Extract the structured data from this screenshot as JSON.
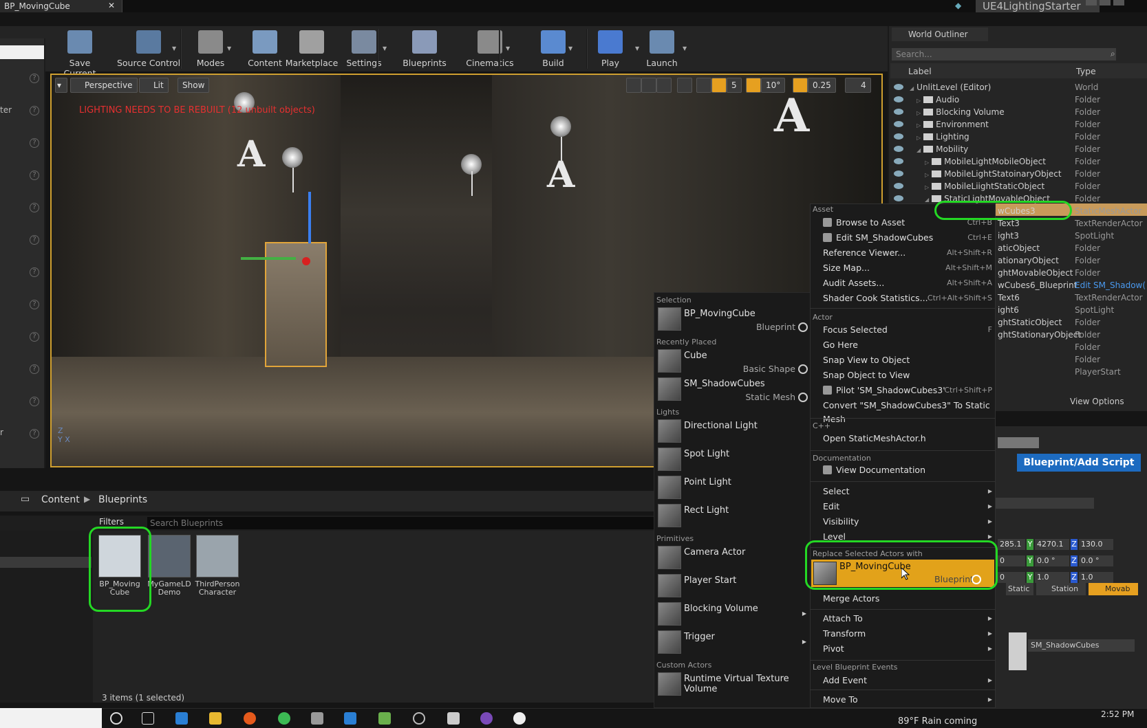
{
  "window": {
    "tab_title": "BP_MovingCube",
    "project_name": "UE4LightingStarter"
  },
  "toolbar": {
    "buttons": [
      "Save Current",
      "Source Control",
      "Modes",
      "Content",
      "Marketplace",
      "Settings",
      "Blueprints",
      "Cinematics",
      "Build",
      "Play",
      "Launch"
    ]
  },
  "viewport": {
    "perspective": "Perspective",
    "lit": "Lit",
    "show": "Show",
    "warning": "LIGHTING NEEDS TO BE REBUILT (12 unbuilt objects)",
    "grid_snap": "5",
    "rot_snap": "10°",
    "scale_snap": "0.25",
    "cam_speed": "4"
  },
  "left_labels": [
    "ter",
    "r"
  ],
  "outliner": {
    "title": "World Outliner",
    "search_placeholder": "Search...",
    "col_label": "Label",
    "col_type": "Type",
    "rows": [
      {
        "label": "UnlitLevel (Editor)",
        "type": "World"
      },
      {
        "label": "Audio",
        "type": "Folder"
      },
      {
        "label": "Blocking Volume",
        "type": "Folder"
      },
      {
        "label": "Environment",
        "type": "Folder"
      },
      {
        "label": "Lighting",
        "type": "Folder"
      },
      {
        "label": "Mobility",
        "type": "Folder"
      },
      {
        "label": "MobileLightMobileObject",
        "type": "Folder"
      },
      {
        "label": "MobileLightStatoinaryObject",
        "type": "Folder"
      },
      {
        "label": "MobileLiightStaticObject",
        "type": "Folder"
      },
      {
        "label": "StaticLightMovableObject",
        "type": "Folder"
      },
      {
        "label": "wCubes3",
        "type": "StaticMeshActor"
      },
      {
        "label": "Text3",
        "type": "TextRenderActor"
      },
      {
        "label": "ight3",
        "type": "SpotLight"
      },
      {
        "label": "aticObject",
        "type": "Folder"
      },
      {
        "label": "ationaryObject",
        "type": "Folder"
      },
      {
        "label": "ghtMovableObject",
        "type": "Folder"
      },
      {
        "label": "wCubes6_Blueprint",
        "type": "Edit SM_Shadow("
      },
      {
        "label": "Text6",
        "type": "TextRenderActor"
      },
      {
        "label": "ight6",
        "type": "SpotLight"
      },
      {
        "label": "ghtStaticObject",
        "type": "Folder"
      },
      {
        "label": "ghtStationaryObject",
        "type": "Folder"
      },
      {
        "label": "",
        "type": "Folder"
      },
      {
        "label": "",
        "type": "Folder"
      },
      {
        "label": "",
        "type": "PlayerStart"
      }
    ],
    "view_options": "View Options"
  },
  "details": {
    "blueprint_button": "Blueprint/Add Script",
    "loc": [
      "285.1",
      "4270.1",
      "130.0"
    ],
    "rot": [
      "0",
      "0.0 °",
      "0.0 °"
    ],
    "scale": [
      "0",
      "1.0",
      "1.0"
    ],
    "mobility": [
      "Static",
      "Station",
      "Movab"
    ],
    "mesh": "SM_ShadowCubes"
  },
  "content_browser": {
    "crumb_content": "Content",
    "crumb_blueprints": "Blueprints",
    "filters": "Filters",
    "search_placeholder": "Search Blueprints",
    "assets": [
      {
        "name": "BP_Moving\nCube"
      },
      {
        "name": "MyGameLD\nDemo"
      },
      {
        "name": "ThirdPerson\nCharacter"
      }
    ],
    "count": "3 items (1 selected)"
  },
  "place_menu": {
    "sections": [
      {
        "title": "Selection",
        "items": [
          {
            "name": "BP_MovingCube",
            "type": "Blueprint",
            "circle": true
          }
        ]
      },
      {
        "title": "Recently Placed",
        "items": [
          {
            "name": "Cube",
            "type": "Basic Shape",
            "circle": true
          },
          {
            "name": "SM_ShadowCubes",
            "type": "Static Mesh",
            "circle": true
          }
        ]
      },
      {
        "title": "Lights",
        "items": [
          {
            "name": "Directional Light"
          },
          {
            "name": "Spot Light"
          },
          {
            "name": "Point Light"
          },
          {
            "name": "Rect Light"
          }
        ]
      },
      {
        "title": "Primitives",
        "items": [
          {
            "name": "Camera Actor"
          },
          {
            "name": "Player Start"
          },
          {
            "name": "Blocking Volume",
            "arrow": true
          },
          {
            "name": "Trigger",
            "arrow": true
          }
        ]
      },
      {
        "title": "Custom Actors",
        "items": [
          {
            "name": "Runtime Virtual Texture Volume"
          }
        ]
      }
    ]
  },
  "context_menu": {
    "asset_title": "Asset",
    "asset_items": [
      {
        "label": "Browse to Asset",
        "shortcut": "Ctrl+B",
        "icon": true
      },
      {
        "label": "Edit SM_ShadowCubes",
        "shortcut": "Ctrl+E",
        "icon": true
      },
      {
        "label": "Reference Viewer...",
        "shortcut": "Alt+Shift+R"
      },
      {
        "label": "Size Map...",
        "shortcut": "Alt+Shift+M"
      },
      {
        "label": "Audit Assets...",
        "shortcut": "Alt+Shift+A"
      },
      {
        "label": "Shader Cook Statistics...",
        "shortcut": "Ctrl+Alt+Shift+S"
      }
    ],
    "actor_title": "Actor",
    "actor_items": [
      {
        "label": "Focus Selected",
        "shortcut": "F"
      },
      {
        "label": "Go Here",
        "shortcut": ""
      },
      {
        "label": "Snap View to Object",
        "shortcut": ""
      },
      {
        "label": "Snap Object to View",
        "shortcut": ""
      },
      {
        "label": "Pilot 'SM_ShadowCubes3'",
        "shortcut": "Ctrl+Shift+P",
        "icon": true
      },
      {
        "label": "Convert \"SM_ShadowCubes3\" To Static Mesh",
        "shortcut": ""
      }
    ],
    "cpp_title": "C++",
    "cpp_item": "Open StaticMeshActor.h",
    "doc_title": "Documentation",
    "doc_item": "View Documentation",
    "sub_items": [
      "Select",
      "Edit",
      "Visibility",
      "Level"
    ],
    "replace_title": "Replace Selected Actors with",
    "replace_name": "BP_MovingCube",
    "replace_type": "Blueprint",
    "merge": "Merge Actors",
    "sub_items2": [
      "Attach To",
      "Transform",
      "Pivot"
    ],
    "lbe_title": "Level Blueprint Events",
    "add_event": "Add Event",
    "move_to": "Move To"
  },
  "taskbar": {
    "weather": "89°F  Rain coming",
    "time": "2:52 PM"
  }
}
